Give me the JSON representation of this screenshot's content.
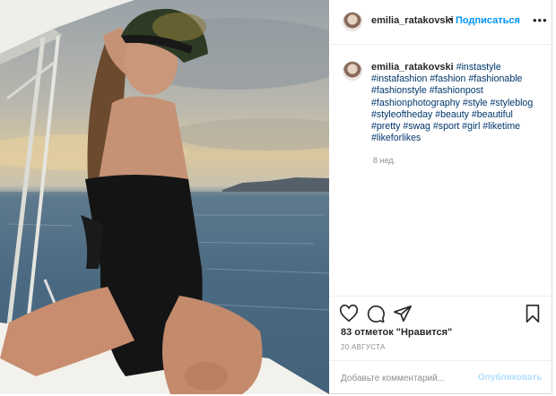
{
  "post": {
    "username": "emilia_ratakovski",
    "follow_label": "Подписаться",
    "caption_tags": "#instastyle #instafashion #fashion #fashionable #fashionstyle #fashionpost #fashionphotography #style #styleblog #styleoftheday #beauty #beautiful #pretty #swag #sport #girl #liketime #likeforlikes",
    "time_ago": "8 нед.",
    "likes_text": "83 отметок \"Нравится\"",
    "date": "20 АВГУСТА",
    "comment_placeholder": "Добавьте комментарий...",
    "publish_label": "Опубликовать"
  },
  "colors": {
    "link": "#00376b",
    "follow": "#0095f6",
    "publish_disabled": "#b2dffc",
    "muted": "#8e8e8e"
  },
  "icons": {
    "like": "heart-icon",
    "comment": "comment-icon",
    "share": "share-icon",
    "save": "bookmark-icon",
    "more": "more-options-icon"
  }
}
